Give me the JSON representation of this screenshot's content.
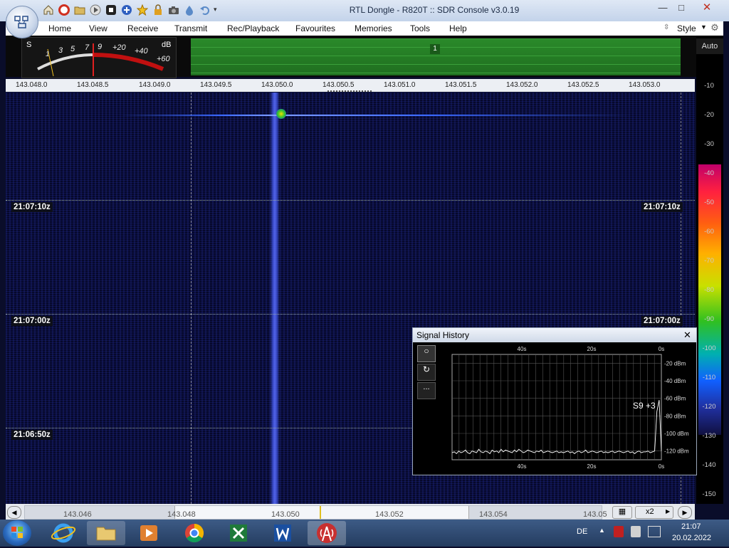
{
  "window": {
    "title": "RTL Dongle - R820T :: SDR Console v3.0.19",
    "minimize": "—",
    "maximize": "□",
    "close": "✕"
  },
  "menu": {
    "items": [
      "Home",
      "View",
      "Receive",
      "Transmit",
      "Rec/Playback",
      "Favourites",
      "Memories",
      "Tools",
      "Help"
    ],
    "style_label": "Style"
  },
  "smeter": {
    "s_label": "S",
    "db_label": "dB",
    "scale": [
      "1",
      "3",
      "5",
      "7",
      "9",
      "+20",
      "+40",
      "+60"
    ]
  },
  "spectrum": {
    "marker": "1"
  },
  "freq_scale": {
    "labels": [
      "143.048.0",
      "143.048.5",
      "143.049.0",
      "143.049.5",
      "143.050.0",
      "143.050.5",
      "143.051.0",
      "143.051.5",
      "143.052.0",
      "143.052.5",
      "143.053.0"
    ]
  },
  "waterfall": {
    "times": [
      "21:07:10z",
      "21:07:00z",
      "21:06:50z"
    ]
  },
  "right_scale": {
    "auto_label": "Auto",
    "values": [
      "-10",
      "-20",
      "-30",
      "-40",
      "-50",
      "-60",
      "-70",
      "-80",
      "-90",
      "-100",
      "-110",
      "-120",
      "-130",
      "-140",
      "-150"
    ]
  },
  "signal_history": {
    "title": "Signal History",
    "close": "✕",
    "time_top": [
      "40s",
      "20s",
      "0s"
    ],
    "time_bottom": [
      "40s",
      "20s",
      "0s"
    ],
    "dbm_labels": [
      "-20 dBm",
      "-40 dBm",
      "-60 dBm",
      "-80 dBm",
      "-100 dBm",
      "-120 dBm"
    ],
    "readout": "S9 +3",
    "btn_more": "..."
  },
  "bottom_bar": {
    "freq_labels": [
      "143.046",
      "143.048",
      "143.050",
      "143.052",
      "143.054",
      "143.05"
    ],
    "zoom": "x2"
  },
  "taskbar": {
    "language": "DE",
    "time": "21:07",
    "date": "20.02.2022"
  },
  "chart_data": {
    "type": "line",
    "title": "Signal History",
    "xlabel": "",
    "ylabel": "",
    "x_ticks": [
      "40s",
      "20s",
      "0s"
    ],
    "ylim": [
      -130,
      -10
    ],
    "y_ticks": [
      "-20 dBm",
      "-40 dBm",
      "-60 dBm",
      "-80 dBm",
      "-100 dBm",
      "-120 dBm"
    ],
    "series": [
      {
        "values": [
          -122,
          -121,
          -123,
          -120,
          -122,
          -121,
          -119,
          -122,
          -123,
          -120,
          -121,
          -122,
          -118,
          -121,
          -122,
          -120,
          -121,
          -123,
          -119,
          -121,
          -120,
          -122,
          -118,
          -121,
          -119,
          -120,
          -121,
          -122,
          -119,
          -121,
          -118,
          -120,
          -122,
          -121,
          -119,
          -120,
          -121,
          -122,
          -120,
          -121,
          -119,
          -122,
          -121,
          -120,
          -121,
          -122,
          -121,
          -120,
          -122,
          -121,
          -122,
          -121,
          -120,
          -122,
          -121,
          -123,
          -121,
          -120,
          -122,
          -121,
          -119,
          -122,
          -121,
          -120,
          -121,
          -122,
          -121,
          -120,
          -122,
          -121,
          -122,
          -121,
          -120,
          -122,
          -121,
          -120,
          -121,
          -122,
          -121,
          -120,
          -122,
          -121,
          -123,
          -121,
          -120,
          -122,
          -121,
          -121,
          -120,
          -122,
          -121,
          -120,
          -75,
          -62,
          -120
        ]
      }
    ]
  }
}
